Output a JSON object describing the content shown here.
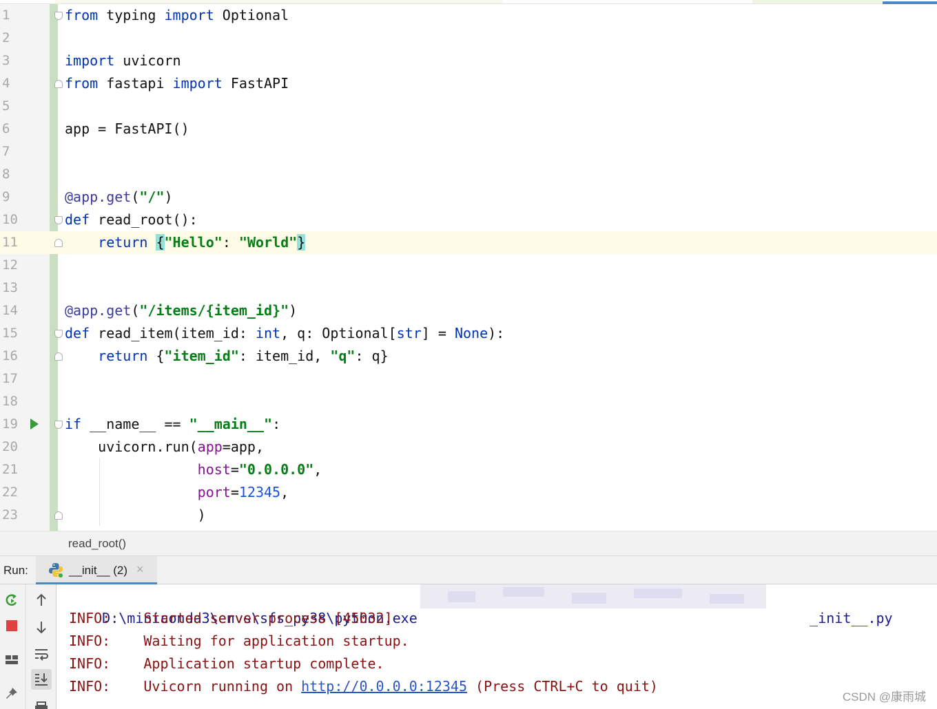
{
  "editor": {
    "line_numbers": [
      "1",
      "2",
      "3",
      "4",
      "5",
      "6",
      "7",
      "8",
      "9",
      "10",
      "11",
      "12",
      "13",
      "14",
      "15",
      "16",
      "17",
      "18",
      "19",
      "20",
      "21",
      "22",
      "23"
    ],
    "lines": [
      [
        {
          "t": "from",
          "c": "kw"
        },
        {
          "t": " typing "
        },
        {
          "t": "import",
          "c": "kw"
        },
        {
          "t": " Optional"
        }
      ],
      [],
      [
        {
          "t": "import",
          "c": "kw"
        },
        {
          "t": " uvicorn"
        }
      ],
      [
        {
          "t": "from",
          "c": "kw"
        },
        {
          "t": " fastapi "
        },
        {
          "t": "import",
          "c": "kw"
        },
        {
          "t": " FastAPI"
        }
      ],
      [],
      [
        {
          "t": "app = FastAPI()"
        }
      ],
      [],
      [],
      [
        {
          "t": "@app.get",
          "c": "deco"
        },
        {
          "t": "("
        },
        {
          "t": "\"/\"",
          "c": "str"
        },
        {
          "t": ")"
        }
      ],
      [
        {
          "t": "def",
          "c": "kw"
        },
        {
          "t": " read_root():"
        }
      ],
      [
        {
          "t": "    "
        },
        {
          "t": "return",
          "c": "kw"
        },
        {
          "t": " "
        },
        {
          "t": "{",
          "c": "brace-hl"
        },
        {
          "t": "\"Hello\"",
          "c": "str"
        },
        {
          "t": ": "
        },
        {
          "t": "\"World\"",
          "c": "str"
        },
        {
          "t": "}",
          "c": "brace-hl"
        }
      ],
      [],
      [],
      [
        {
          "t": "@app.get",
          "c": "deco"
        },
        {
          "t": "("
        },
        {
          "t": "\"/items/{item_id}\"",
          "c": "str"
        },
        {
          "t": ")"
        }
      ],
      [
        {
          "t": "def",
          "c": "kw"
        },
        {
          "t": " read_item(item_id: "
        },
        {
          "t": "int",
          "c": "kw"
        },
        {
          "t": ", q: Optional["
        },
        {
          "t": "str",
          "c": "kw"
        },
        {
          "t": "] = "
        },
        {
          "t": "None",
          "c": "kw"
        },
        {
          "t": "):"
        }
      ],
      [
        {
          "t": "    "
        },
        {
          "t": "return",
          "c": "kw"
        },
        {
          "t": " {"
        },
        {
          "t": "\"item_id\"",
          "c": "str"
        },
        {
          "t": ": item_id, "
        },
        {
          "t": "\"q\"",
          "c": "str"
        },
        {
          "t": ": q}"
        }
      ],
      [],
      [],
      [
        {
          "t": "if",
          "c": "kw"
        },
        {
          "t": " __name__ == "
        },
        {
          "t": "\"__main__\"",
          "c": "str"
        },
        {
          "t": ":"
        }
      ],
      [
        {
          "t": "    uvicorn.run("
        },
        {
          "t": "app",
          "c": "param"
        },
        {
          "t": "=app,"
        }
      ],
      [
        {
          "t": "                "
        },
        {
          "t": "host",
          "c": "param"
        },
        {
          "t": "="
        },
        {
          "t": "\"0.0.0.0\"",
          "c": "str"
        },
        {
          "t": ","
        }
      ],
      [
        {
          "t": "                "
        },
        {
          "t": "port",
          "c": "param"
        },
        {
          "t": "="
        },
        {
          "t": "12345",
          "c": "num"
        },
        {
          "t": ","
        }
      ],
      [
        {
          "t": "                )"
        }
      ]
    ],
    "current_line": 11,
    "run_marker_line": 19,
    "fold_open_lines": [
      1,
      10,
      15,
      19
    ],
    "fold_close_lines": [
      4,
      11,
      16,
      23
    ]
  },
  "breadcrumb": {
    "label": "read_root()"
  },
  "run_panel": {
    "label": "Run:",
    "tab_label": "__init__ (2)",
    "tab_close": "×"
  },
  "console": {
    "cmd_prefix": "D:\\miniconda3\\envs\\sfs_py38\\python.exe",
    "cmd_suffix": "_init__.py",
    "lines": [
      {
        "level": "INFO:",
        "message": "Started server process [45032]"
      },
      {
        "level": "INFO:",
        "message": "Waiting for application startup."
      },
      {
        "level": "INFO:",
        "message": "Application startup complete."
      }
    ],
    "last_line": {
      "level": "INFO:",
      "before_link": "Uvicorn running on ",
      "link": "http://0.0.0.0:12345",
      "after_link": " (Press CTRL+C to quit)"
    }
  },
  "colors": {
    "keyword": "#0033b3",
    "string": "#067d17",
    "number": "#1750eb",
    "param": "#871094",
    "console_info": "#8a1111",
    "console_cmd": "#1a1a8a",
    "link": "#2a56c6",
    "run_green": "#3b9b3b",
    "stop_red": "#e04040"
  },
  "icons": {
    "run_marker": "run-triangle-icon",
    "rerun": "rerun-icon",
    "stop": "stop-icon",
    "scroll_up": "arrow-up-icon",
    "scroll_down": "arrow-down-icon",
    "soft_wrap": "soft-wrap-icon",
    "scroll_to_end": "scroll-to-end-icon",
    "layout": "layout-icon",
    "pin": "pin-icon",
    "print": "print-icon",
    "python": "python-icon"
  },
  "watermark": "CSDN @康雨城"
}
